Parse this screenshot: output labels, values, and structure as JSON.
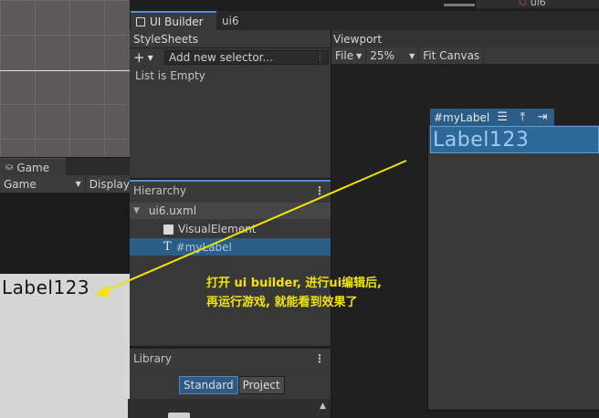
{
  "top_bar": {
    "right_label": "ui6"
  },
  "game_window": {
    "tab_label": "Game",
    "toolbar_dropdown": "Game",
    "display_label": "Display",
    "rendered_label": "Label123"
  },
  "ui_builder": {
    "tabs": [
      {
        "label": "UI Builder"
      },
      {
        "label": "ui6"
      }
    ],
    "stylesheets": {
      "title": "StyleSheets",
      "add_button": "+",
      "selector_placeholder": "Add new selector...",
      "empty_text": "List is Empty"
    },
    "hierarchy": {
      "title": "Hierarchy",
      "root": "ui6.uxml",
      "items": [
        {
          "label": "VisualElement",
          "icon": "square-icon"
        },
        {
          "label": "#myLabel",
          "icon": "text-icon",
          "selected": true
        }
      ]
    },
    "library": {
      "title": "Library",
      "tabs": [
        {
          "label": "Standard",
          "active": true
        },
        {
          "label": "Project",
          "active": false
        }
      ]
    },
    "viewport": {
      "title": "Viewport",
      "toolbar": {
        "file": "File",
        "zoom": "25%",
        "fit": "Fit Canvas"
      },
      "selected_tag": "#myLabel",
      "canvas_label": "Label123"
    }
  },
  "annotation": {
    "text_line1": "打开 ui builder, 进行ui编辑后,",
    "text_line2": "再运行游戏, 就能看到效果了",
    "color": "#f1e30b"
  }
}
